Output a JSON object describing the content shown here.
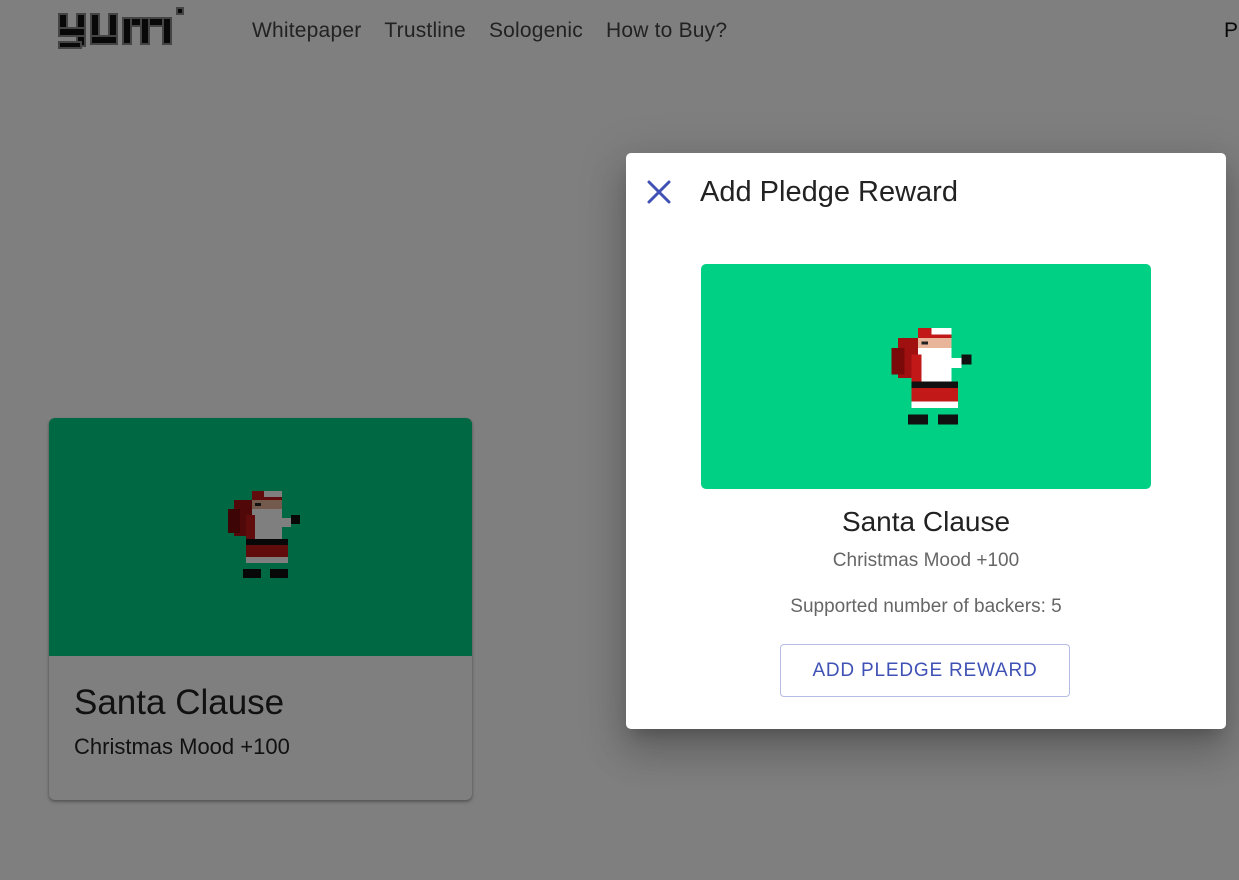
{
  "brand": {
    "logo_text": "yum"
  },
  "nav": {
    "items": [
      "Whitepaper",
      "Trustline",
      "Sologenic",
      "How to Buy?"
    ],
    "right_partial": "P"
  },
  "card": {
    "title": "Santa Clause",
    "subtitle": "Christmas Mood +100",
    "media_color": "#00d084"
  },
  "dialog": {
    "title": "Add Pledge Reward",
    "close_icon": "close-icon",
    "reward": {
      "name": "Santa Clause",
      "description": "Christmas Mood +100",
      "backers_label": "Supported number of backers: ",
      "backers_count": "5",
      "media_color": "#00d084"
    },
    "action_label": "ADD PLEDGE REWARD"
  },
  "colors": {
    "accent": "#3f51b5",
    "reward_bg": "#00d084",
    "overlay": "rgba(0,0,0,0.5)"
  }
}
